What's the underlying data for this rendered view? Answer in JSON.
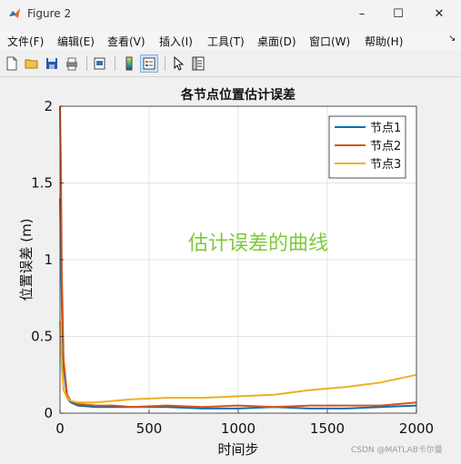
{
  "window": {
    "title": "Figure 2"
  },
  "menu": {
    "items": [
      "文件(F)",
      "编辑(E)",
      "查看(V)",
      "插入(I)",
      "工具(T)",
      "桌面(D)",
      "窗口(W)",
      "帮助(H)"
    ]
  },
  "toolbar": {
    "icons": [
      "new-file-icon",
      "open-folder-icon",
      "save-icon",
      "print-icon",
      "print-preview-icon",
      "colorbar-icon",
      "legend-icon",
      "pointer-icon",
      "property-inspector-icon"
    ]
  },
  "chart_data": {
    "type": "line",
    "title": "各节点位置估计误差",
    "xlabel": "时间步",
    "ylabel": "位置误差 (m)",
    "xlim": [
      0,
      2000
    ],
    "ylim": [
      0,
      2
    ],
    "xticks": [
      0,
      500,
      1000,
      1500,
      2000
    ],
    "yticks": [
      0,
      0.5,
      1,
      1.5,
      2
    ],
    "grid": true,
    "legend_position": "top-right",
    "annotation": "估计误差的曲线",
    "series": [
      {
        "name": "节点1",
        "color": "#0072BD",
        "x": [
          0,
          5,
          10,
          20,
          40,
          60,
          100,
          200,
          300,
          400,
          600,
          800,
          1000,
          1200,
          1400,
          1600,
          1800,
          2000
        ],
        "y": [
          1.4,
          1.1,
          0.7,
          0.3,
          0.1,
          0.07,
          0.05,
          0.04,
          0.04,
          0.04,
          0.04,
          0.03,
          0.03,
          0.04,
          0.03,
          0.03,
          0.04,
          0.05
        ]
      },
      {
        "name": "节点2",
        "color": "#D95319",
        "x": [
          0,
          5,
          10,
          20,
          40,
          60,
          100,
          200,
          300,
          400,
          600,
          800,
          1000,
          1200,
          1400,
          1600,
          1800,
          2000
        ],
        "y": [
          2.0,
          1.6,
          0.9,
          0.35,
          0.12,
          0.08,
          0.06,
          0.05,
          0.05,
          0.04,
          0.05,
          0.04,
          0.05,
          0.04,
          0.05,
          0.05,
          0.05,
          0.07
        ]
      },
      {
        "name": "节点3",
        "color": "#EDB120",
        "x": [
          0,
          5,
          10,
          20,
          40,
          60,
          100,
          200,
          300,
          400,
          600,
          800,
          1000,
          1200,
          1400,
          1600,
          1800,
          2000
        ],
        "y": [
          0.6,
          0.45,
          0.3,
          0.15,
          0.1,
          0.08,
          0.07,
          0.07,
          0.08,
          0.09,
          0.1,
          0.1,
          0.11,
          0.12,
          0.15,
          0.17,
          0.2,
          0.25
        ]
      }
    ]
  },
  "watermark": "CSDN @MATLAB卡尔曼"
}
